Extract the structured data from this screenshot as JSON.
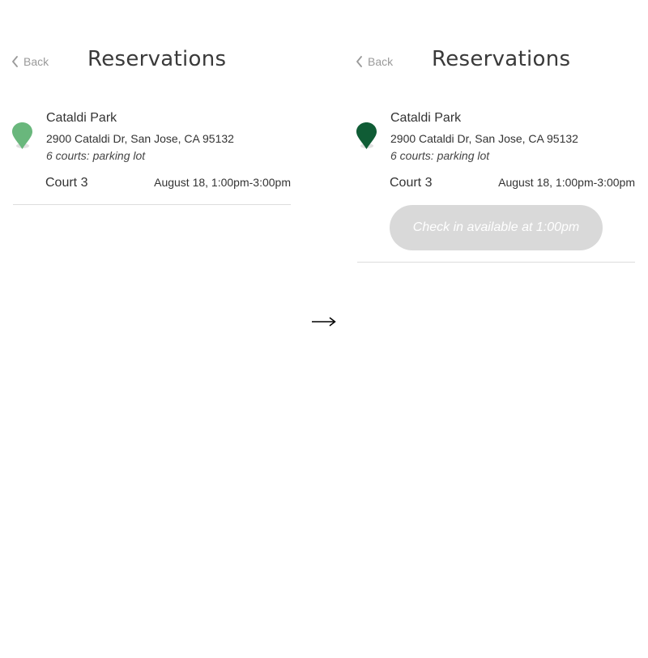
{
  "before": {
    "back_label": "Back",
    "title": "Reservations",
    "pin_color": "#69b77c",
    "park": {
      "name": "Cataldi Park",
      "address": "2900 Cataldi Dr, San Jose, CA 95132",
      "courts": "6 courts: parking lot"
    },
    "reservation": {
      "court": "Court 3",
      "time": "August 18, 1:00pm-3:00pm"
    }
  },
  "after": {
    "back_label": "Back",
    "title": "Reservations",
    "pin_color": "#0f5c35",
    "park": {
      "name": "Cataldi Park",
      "address": "2900 Cataldi Dr, San Jose, CA 95132",
      "courts": "6 courts: parking lot"
    },
    "reservation": {
      "court": "Court 3",
      "time": "August 18, 1:00pm-3:00pm"
    },
    "checkin_label": "Check in available at 1:00pm"
  },
  "transition_icon": "right-arrow-icon"
}
